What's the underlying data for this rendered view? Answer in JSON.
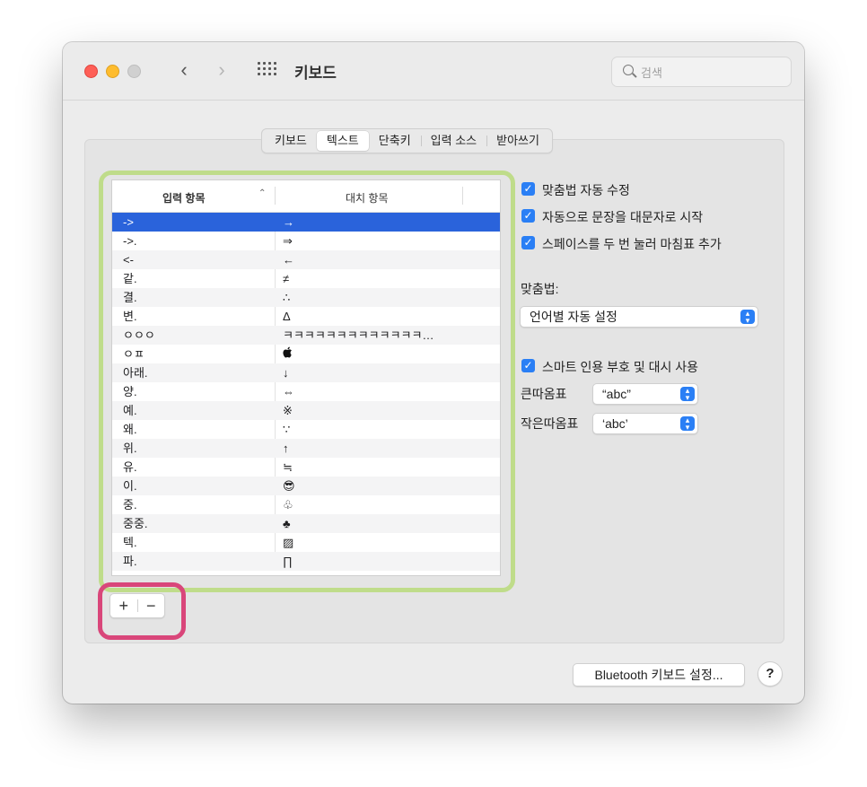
{
  "window": {
    "title": "키보드"
  },
  "search": {
    "placeholder": "검색"
  },
  "tabs": [
    "키보드",
    "텍스트",
    "단축키",
    "입력 소스",
    "받아쓰기"
  ],
  "active_tab": 1,
  "table": {
    "col1_header": "입력 항목",
    "col2_header": "대치 항목",
    "rows": [
      {
        "input": "->",
        "replace": "→"
      },
      {
        "input": "->.",
        "replace": "⇒"
      },
      {
        "input": "<-",
        "replace": "←"
      },
      {
        "input": "같.",
        "replace": "≠"
      },
      {
        "input": "결.",
        "replace": "∴"
      },
      {
        "input": "변.",
        "replace": "Δ"
      },
      {
        "input": "ㅇㅇㅇ",
        "replace": "ㅋㅋㅋㅋㅋㅋㅋㅋㅋㅋㅋㅋㅋ…"
      },
      {
        "input": "ㅇㅍ",
        "replace": ""
      },
      {
        "input": "아래.",
        "replace": "↓"
      },
      {
        "input": "양.",
        "replace": "⇔"
      },
      {
        "input": "예.",
        "replace": "※"
      },
      {
        "input": "왜.",
        "replace": "∵"
      },
      {
        "input": "위.",
        "replace": "↑"
      },
      {
        "input": "유.",
        "replace": "≒"
      },
      {
        "input": "이.",
        "replace": "😎"
      },
      {
        "input": "중.",
        "replace": "♧"
      },
      {
        "input": "중중.",
        "replace": "♣"
      },
      {
        "input": "텍.",
        "replace": "▨"
      },
      {
        "input": "파.",
        "replace": "∏"
      }
    ]
  },
  "buttons": {
    "add": "+",
    "remove": "−"
  },
  "options": {
    "autocorrect": "맞춤법 자동 수정",
    "capitalize": "자동으로 문장을 대문자로 시작",
    "period": "스페이스를 두 번 눌러 마침표 추가",
    "spelling_label": "맞춤법:",
    "spelling_value": "언어별 자동 설정",
    "smart_quotes": "스마트 인용 부호 및 대시 사용",
    "double_label": "큰따옴표",
    "double_value": "“abc”",
    "single_label": "작은따옴표",
    "single_value": "‘abc’"
  },
  "footer": {
    "bluetooth": "Bluetooth 키보드 설정...",
    "help": "?"
  },
  "colors": {
    "accent": "#2a7ff5",
    "selection": "#2a63db",
    "highlight_green": "#bfdc8a",
    "highlight_pink": "#d9467a"
  }
}
